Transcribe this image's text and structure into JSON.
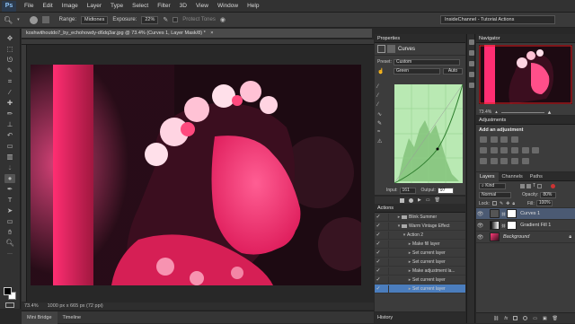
{
  "app": {
    "logo": "Ps"
  },
  "menu": [
    "File",
    "Edit",
    "Image",
    "Layer",
    "Type",
    "Select",
    "Filter",
    "3D",
    "View",
    "Window",
    "Help"
  ],
  "options_bar": {
    "range_label": "Range:",
    "range_value": "Midtones",
    "exposure_label": "Exposure:",
    "exposure_value": "22%",
    "protect_label": "Protect Tones",
    "workspace": "InsideChannel - Tutorial Actions"
  },
  "document": {
    "tab_title": "koshwithoutdo7_by_echohowdy-d6dq3ar.jpg @ 73.4% (Curves 1, Layer Mask/8) *",
    "zoom": "73.4%",
    "doc_size": "1000 px x 665 px (72 ppi)"
  },
  "bottom_tabs": [
    "Mini Bridge",
    "Timeline"
  ],
  "properties": {
    "title": "Properties",
    "panel_name": "Curves",
    "preset_label": "Preset:",
    "preset_value": "Custom",
    "channel_value": "Green",
    "auto_label": "Auto",
    "input_label": "Input:",
    "input_value": "161",
    "output_label": "Output:",
    "output_value": "97"
  },
  "actions": {
    "title": "Actions",
    "items": [
      {
        "label": "Blink Summer",
        "indent": 1,
        "check": "✓",
        "tri": "▸",
        "folder": true
      },
      {
        "label": "Warm Vintage Effect",
        "indent": 1,
        "check": "✓",
        "tri": "▾",
        "folder": true
      },
      {
        "label": "Action 2",
        "indent": 2,
        "check": "✓",
        "tri": "▾",
        "folder": false
      },
      {
        "label": "Make fill layer",
        "indent": 3,
        "check": "✓",
        "tri": "▸",
        "folder": false
      },
      {
        "label": "Set current layer",
        "indent": 3,
        "check": "✓",
        "tri": "▸",
        "folder": false
      },
      {
        "label": "Set current layer",
        "indent": 3,
        "check": "✓",
        "tri": "▸",
        "folder": false
      },
      {
        "label": "Make adjustment la...",
        "indent": 3,
        "check": "✓",
        "tri": "▸",
        "folder": false
      },
      {
        "label": "Set current layer",
        "indent": 3,
        "check": "✓",
        "tri": "▸",
        "folder": false
      },
      {
        "label": "Set current layer",
        "indent": 3,
        "check": "✓",
        "tri": "▸",
        "folder": false,
        "selected": true
      }
    ]
  },
  "history_tab": "History",
  "navigator": {
    "title": "Navigator",
    "zoom": "73.4%"
  },
  "adjustments": {
    "title": "Adjustments",
    "subtitle": "Add an adjustment"
  },
  "layers": {
    "tabs": [
      "Layers",
      "Channels",
      "Paths"
    ],
    "kind_label": "Kind",
    "blend_mode": "Normal",
    "opacity_label": "Opacity:",
    "opacity_value": "80%",
    "lock_label": "Lock:",
    "fill_label": "Fill:",
    "fill_value": "100%",
    "items": [
      {
        "name": "Curves 1",
        "selected": true,
        "type": "adjustment"
      },
      {
        "name": "Gradient Fill 1",
        "selected": false,
        "type": "gradient"
      },
      {
        "name": "Background",
        "selected": false,
        "type": "image",
        "locked": true
      }
    ]
  },
  "colors": {
    "accent": "#4b7dbd",
    "curve_bg": "#b9e9b3",
    "curve_line": "#3c8f3c"
  }
}
